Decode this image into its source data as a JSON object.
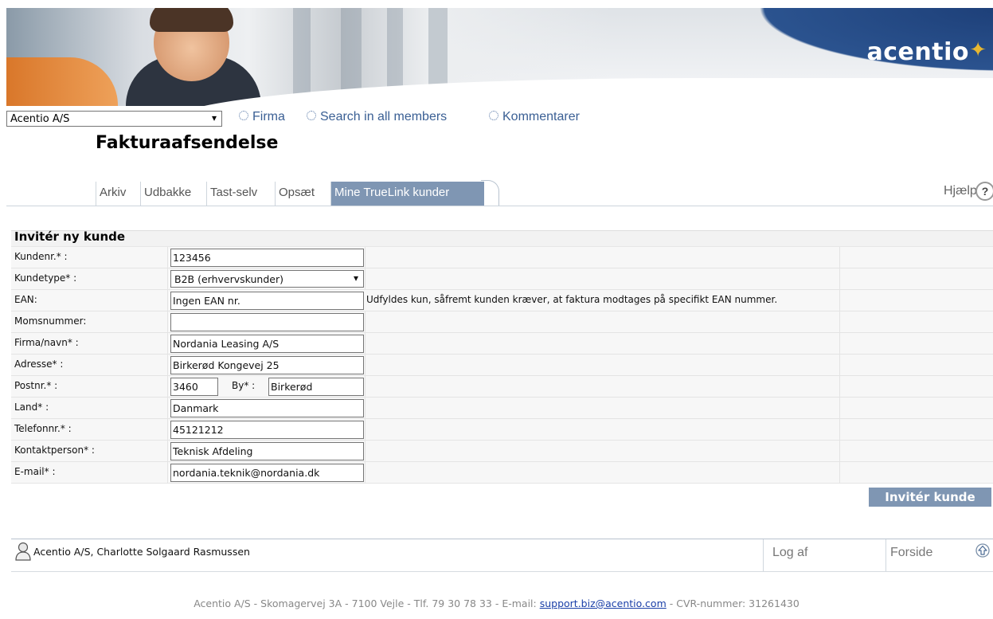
{
  "header": {
    "logo_text": "acentio"
  },
  "topbar": {
    "company_select": "Acentio A/S",
    "radios": [
      "Firma",
      "Search in all members",
      "Kommentarer"
    ]
  },
  "page_title": "Fakturaafsendelse",
  "tabs": [
    "Arkiv",
    "Udbakke",
    "Tast-selv",
    "Opsæt",
    "Mine TrueLink kunder"
  ],
  "active_tab": "Mine TrueLink kunder",
  "help_label": "Hjælp",
  "form": {
    "title": "Invitér ny kunde",
    "customer_no_label": "Kundenr.* :",
    "customer_no": "123456",
    "customer_type_label": "Kundetype* :",
    "customer_type": "B2B (erhvervskunder)",
    "ean_label": "EAN:",
    "ean": "Ingen EAN nr.",
    "ean_hint": "Udfyldes kun, såfremt kunden kræver, at faktura modtages på specifikt EAN nummer.",
    "vat_label": "Momsnummer:",
    "vat": "",
    "company_label": "Firma/navn* :",
    "company": "Nordania Leasing A/S",
    "address_label": "Adresse* :",
    "address": "Birkerød Kongevej 25",
    "zip_label": "Postnr.* :",
    "zip": "3460",
    "city_label": "By* :",
    "city": "Birkerød",
    "country_label": "Land* :",
    "country": "Danmark",
    "phone_label": "Telefonnr.* :",
    "phone": "45121212",
    "contact_label": "Kontaktperson* :",
    "contact": "Teknisk Afdeling",
    "email_label": "E-mail* :",
    "email": "nordania.teknik@nordania.dk",
    "submit_label": "Invitér kunde"
  },
  "userbar": {
    "user": "Acentio A/S, Charlotte Solgaard Rasmussen",
    "logout": "Log af",
    "home": "Forside"
  },
  "footer": {
    "prefix": "Acentio A/S - Skomagervej 3A - 7100 Vejle - Tlf. 79 30 78 33 - E-mail: ",
    "email": "support.biz@acentio.com",
    "suffix": " - CVR-nummer: 31261430"
  },
  "colors": {
    "accent": "#7f96b3",
    "link": "#3a5f94",
    "banner_blue": "#1d3f78"
  }
}
